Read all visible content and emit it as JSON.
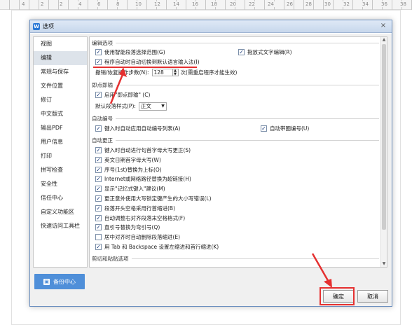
{
  "ruler": {
    "labels": [
      "4",
      "2",
      "2",
      "4",
      "6",
      "8",
      "10",
      "12",
      "14",
      "16",
      "18",
      "20",
      "22",
      "24",
      "26",
      "28",
      "30",
      "32",
      "34",
      "36",
      "38"
    ]
  },
  "dialog": {
    "title": "选项",
    "app_icon": "W"
  },
  "nav": [
    {
      "label": "视图",
      "selected": false
    },
    {
      "label": "编辑",
      "selected": true
    },
    {
      "label": "常规与保存",
      "selected": false
    },
    {
      "label": "文件位置",
      "selected": false
    },
    {
      "label": "修订",
      "selected": false
    },
    {
      "label": "中文版式",
      "selected": false
    },
    {
      "label": "输出PDF",
      "selected": false
    },
    {
      "label": "用户信息",
      "selected": false
    },
    {
      "label": "打印",
      "selected": false
    },
    {
      "label": "拼写检查",
      "selected": false
    },
    {
      "label": "安全性",
      "selected": false
    },
    {
      "label": "信任中心",
      "selected": false
    },
    {
      "label": "自定义功能区",
      "selected": false
    },
    {
      "label": "快速访问工具栏",
      "selected": false
    }
  ],
  "backup_label": "备份中心",
  "sections": {
    "edit": "编辑选项",
    "paste": "即点即输",
    "auto_number": "自动编号",
    "auto_correct": "自动更正",
    "cut_paste": "剪切和粘贴选项"
  },
  "edit_options": {
    "smart_select": "使用智能段落选择范围(G)",
    "drag_drop": "拖放式文字编辑(R)",
    "ime_auto": "程序自动时自动切换到默认语言输入法(I)",
    "undo_label": "撤销/恢复操作步数(N):",
    "undo_value": "128",
    "undo_note": "次(需重启程序才能生效)"
  },
  "click_type": {
    "enable": "启用\"即点即输\" (C)",
    "para_style_label": "默认段落样式(P):",
    "para_style_value": "正文"
  },
  "numbering": {
    "auto_list": "键入时自动应用自动编号列表(A)",
    "auto_circle": "自动带圈编号(U)"
  },
  "autocorrect": [
    "键入时自动进行句首字母大写更正(S)",
    "英文日期首字母大写(W)",
    "序号(1st)替换为上标(O)",
    "Internet或网络路径替换为超链接(H)",
    "显示\"记忆式键入\"建议(M)",
    "更正意外使用大写锁定键产生的大小写错误(L)",
    "段落开头空格采用行首缩进(B)",
    "自动调整右对齐段落末空格格式(F)",
    "直引号替换为弯引号(Q)",
    "居中对齐时自动删除段落缩进(E)",
    "用 Tab 和 Backspace 设置左缩进和首行缩进(K)"
  ],
  "autocorrect_checked": [
    true,
    true,
    true,
    true,
    true,
    true,
    true,
    true,
    true,
    false,
    true
  ],
  "buttons": {
    "ok": "确定",
    "cancel": "取消"
  },
  "colors": {
    "accent": "#4f8fd9",
    "annotation": "#e53030"
  }
}
